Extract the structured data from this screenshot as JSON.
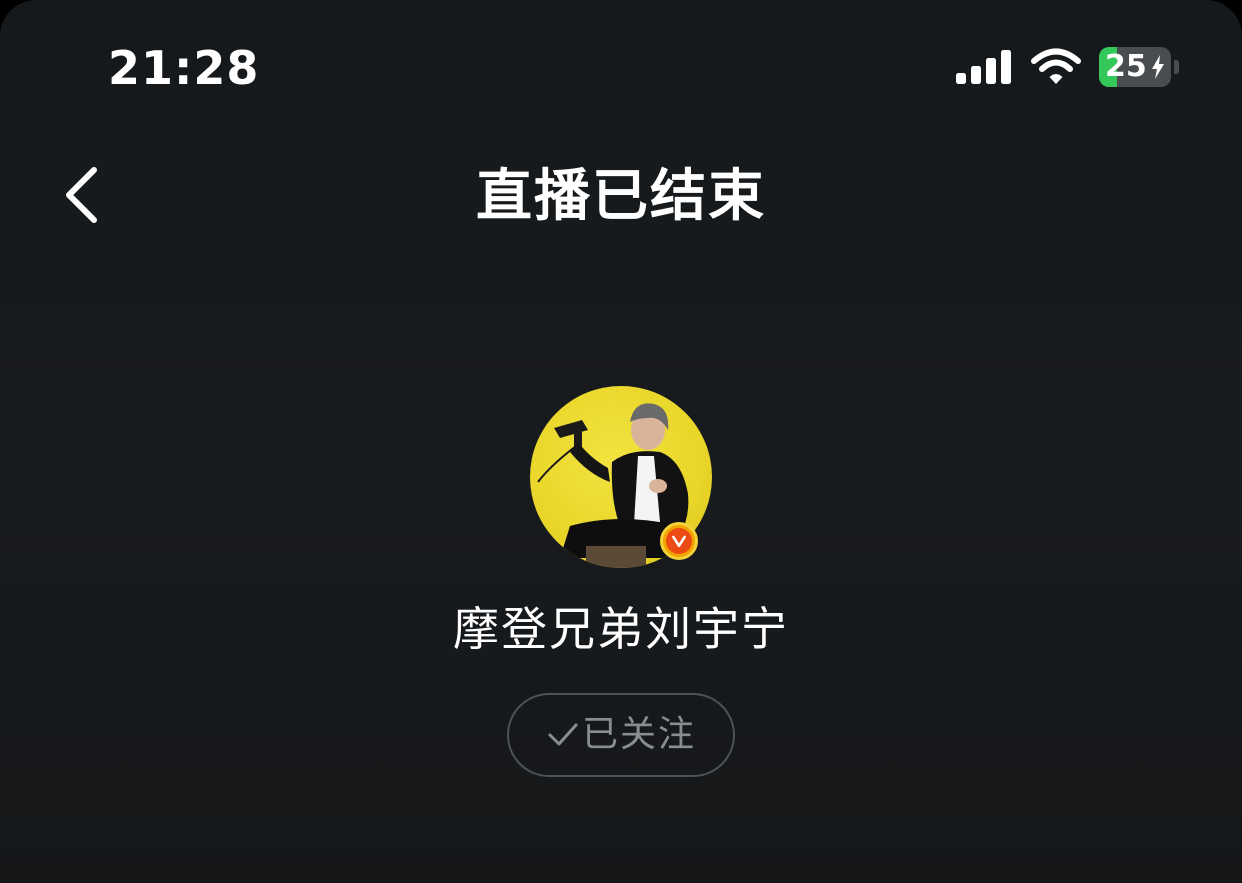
{
  "status_bar": {
    "time": "21:28",
    "signal_icon": "cellular-signal-icon",
    "wifi_icon": "wifi-icon",
    "battery": {
      "level": 25,
      "charging": true,
      "color": "#34c759"
    }
  },
  "nav": {
    "back_icon": "chevron-left-icon",
    "title": "直播已结束"
  },
  "streamer": {
    "avatar_icon": "avatar",
    "avatar_background": "#e9d629",
    "verified_badge": "verified-v-icon",
    "name": "摩登兄弟刘宇宁"
  },
  "follow_button": {
    "check_icon": "checkmark-icon",
    "label": "已关注"
  }
}
